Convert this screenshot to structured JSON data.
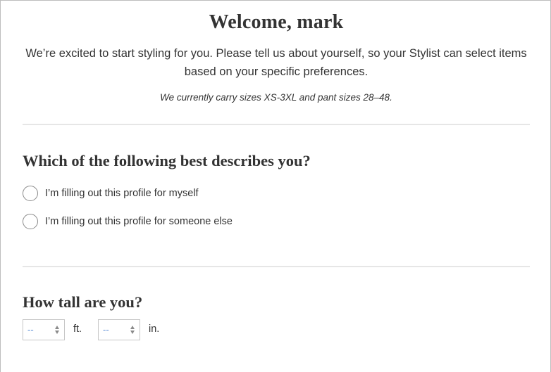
{
  "welcome": {
    "title": "Welcome, mark",
    "intro": "We’re excited to start styling for you. Please tell us about yourself, so your Stylist can select items based on your specific preferences.",
    "sizes_note": "We currently carry sizes XS-3XL and pant sizes 28–48."
  },
  "profile_question": {
    "heading": "Which of the following best describes you?",
    "options": [
      {
        "label": "I’m filling out this profile for myself",
        "selected": false
      },
      {
        "label": "I’m filling out this profile for someone else",
        "selected": false
      }
    ]
  },
  "height_question": {
    "heading": "How tall are you?",
    "feet": {
      "value": "--",
      "unit": "ft."
    },
    "inches": {
      "value": "--",
      "unit": "in."
    }
  },
  "colors": {
    "text": "#333333",
    "select_placeholder": "#5b8fd6",
    "divider": "#e6e6e6",
    "border": "#c6c6c6"
  },
  "icons": {
    "select_arrow": "up-down-arrows-icon",
    "radio": "radio-circle-icon"
  }
}
